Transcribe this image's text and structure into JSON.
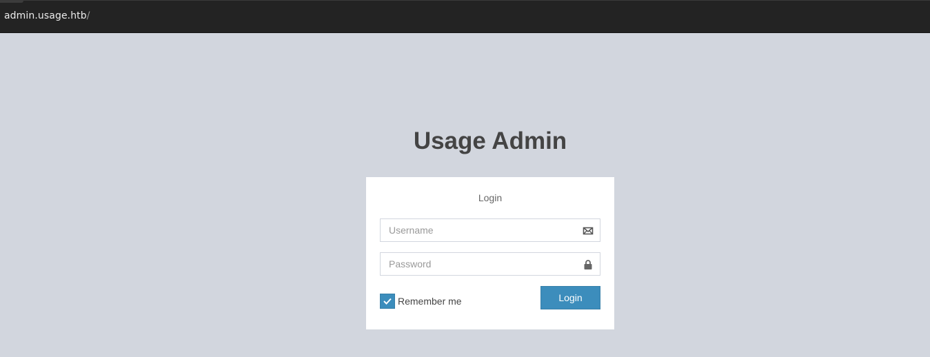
{
  "browser": {
    "url_host": "admin.usage.htb",
    "url_path": "/"
  },
  "page": {
    "title": "Usage Admin"
  },
  "login_box": {
    "message": "Login",
    "username": {
      "value": "",
      "placeholder": "Username",
      "icon": "envelope-icon"
    },
    "password": {
      "value": "",
      "placeholder": "Password",
      "icon": "lock-icon"
    },
    "remember": {
      "label": "Remember me",
      "checked": true
    },
    "submit_label": "Login"
  },
  "colors": {
    "background": "#d2d6de",
    "primary": "#3c8dbc",
    "title": "#444444",
    "urlbar": "#232323"
  }
}
